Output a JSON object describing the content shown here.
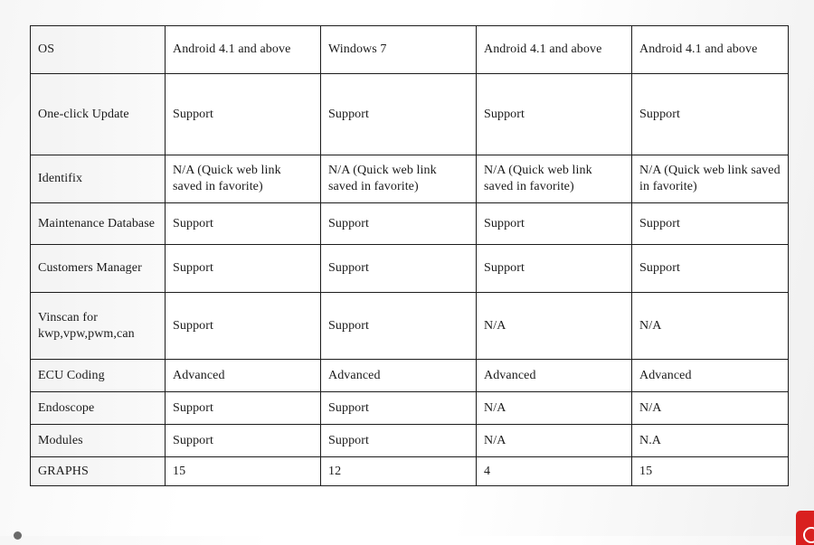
{
  "table": {
    "rows": [
      {
        "feature": "OS",
        "values": [
          "Android 4.1 and above",
          "Windows 7",
          "Android 4.1 and above",
          "Android 4.1 and above"
        ]
      },
      {
        "feature": "One-click Update",
        "values": [
          "Support",
          "Support",
          "Support",
          "Support"
        ]
      },
      {
        "feature": "Identifix",
        "values": [
          "N/A (Quick web link saved in favorite)",
          "N/A (Quick web link saved in favorite)",
          "N/A (Quick web link saved in favorite)",
          "N/A (Quick web link saved in favorite)"
        ]
      },
      {
        "feature": "Maintenance Database",
        "values": [
          "Support",
          "Support",
          "Support",
          "Support"
        ]
      },
      {
        "feature": "Customers Manager",
        "values": [
          "Support",
          "Support",
          "Support",
          "Support"
        ]
      },
      {
        "feature": "Vinscan for kwp,vpw,pwm,can",
        "values": [
          "Support",
          "Support",
          "N/A",
          "N/A"
        ]
      },
      {
        "feature": "ECU Coding",
        "values": [
          "Advanced",
          "Advanced",
          "Advanced",
          "Advanced"
        ]
      },
      {
        "feature": "Endoscope",
        "values": [
          "Support",
          "Support",
          "N/A",
          "N/A"
        ]
      },
      {
        "feature": "Modules",
        "values": [
          "Support",
          "Support",
          "N/A",
          "N.A"
        ]
      },
      {
        "feature": "GRAPHS",
        "values": [
          "15",
          "12",
          "4",
          "15"
        ]
      }
    ]
  },
  "decorations": {
    "corner_badge_icon": "brand-logo-icon",
    "corner_badge_color": "#d9201f"
  }
}
